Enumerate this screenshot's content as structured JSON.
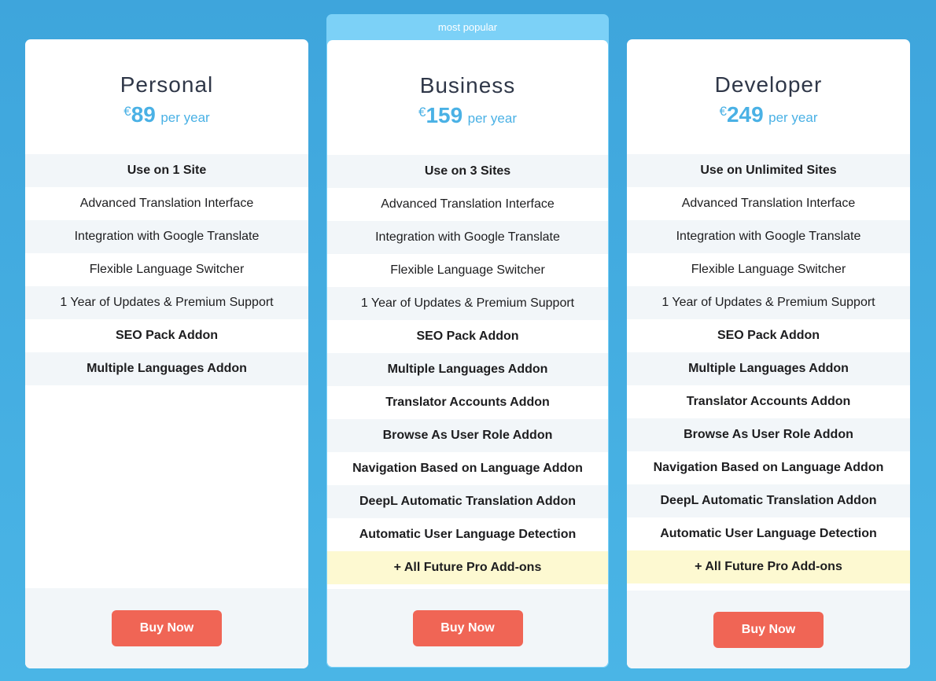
{
  "plans": [
    {
      "name": "Personal",
      "currency": "€",
      "price": "89",
      "period": "per year",
      "badge": null,
      "features": [
        {
          "label": "Use on 1 Site",
          "bold": true
        },
        {
          "label": "Advanced Translation Interface",
          "bold": false
        },
        {
          "label": "Integration with Google Translate",
          "bold": false
        },
        {
          "label": "Flexible Language Switcher",
          "bold": false
        },
        {
          "label": "1 Year of Updates & Premium Support",
          "bold": false
        },
        {
          "label": "SEO Pack Addon",
          "bold": true
        },
        {
          "label": "Multiple Languages Addon",
          "bold": true
        }
      ],
      "button_label": "Buy Now"
    },
    {
      "name": "Business",
      "currency": "€",
      "price": "159",
      "period": "per year",
      "badge": "most popular",
      "features": [
        {
          "label": "Use on 3 Sites",
          "bold": true
        },
        {
          "label": "Advanced Translation Interface",
          "bold": false
        },
        {
          "label": "Integration with Google Translate",
          "bold": false
        },
        {
          "label": "Flexible Language Switcher",
          "bold": false
        },
        {
          "label": "1 Year of Updates & Premium Support",
          "bold": false
        },
        {
          "label": "SEO Pack Addon",
          "bold": true
        },
        {
          "label": "Multiple Languages Addon",
          "bold": true
        },
        {
          "label": "Translator Accounts Addon",
          "bold": true
        },
        {
          "label": "Browse As User Role Addon",
          "bold": true
        },
        {
          "label": "Navigation Based on Language Addon",
          "bold": true
        },
        {
          "label": "DeepL Automatic Translation Addon",
          "bold": true
        },
        {
          "label": "Automatic User Language Detection",
          "bold": true
        },
        {
          "label": "+ All Future Pro Add-ons",
          "bold": true,
          "highlight": true
        }
      ],
      "button_label": "Buy Now"
    },
    {
      "name": "Developer",
      "currency": "€",
      "price": "249",
      "period": "per year",
      "badge": null,
      "features": [
        {
          "label": "Use on Unlimited Sites",
          "bold": true
        },
        {
          "label": "Advanced Translation Interface",
          "bold": false
        },
        {
          "label": "Integration with Google Translate",
          "bold": false
        },
        {
          "label": "Flexible Language Switcher",
          "bold": false
        },
        {
          "label": "1 Year of Updates & Premium Support",
          "bold": false
        },
        {
          "label": "SEO Pack Addon",
          "bold": true
        },
        {
          "label": "Multiple Languages Addon",
          "bold": true
        },
        {
          "label": "Translator Accounts Addon",
          "bold": true
        },
        {
          "label": "Browse As User Role Addon",
          "bold": true
        },
        {
          "label": "Navigation Based on Language Addon",
          "bold": true
        },
        {
          "label": "DeepL Automatic Translation Addon",
          "bold": true
        },
        {
          "label": "Automatic User Language Detection",
          "bold": true
        },
        {
          "label": "+ All Future Pro Add-ons",
          "bold": true,
          "highlight": true
        }
      ],
      "button_label": "Buy Now"
    }
  ],
  "colors": {
    "background": "#3ea5dc",
    "price_accent": "#4ab1e5",
    "popular_band": "#7cd1f7",
    "button": "#f06555",
    "highlight_row": "#fdf9d1",
    "alt_row": "#f2f6f9"
  }
}
